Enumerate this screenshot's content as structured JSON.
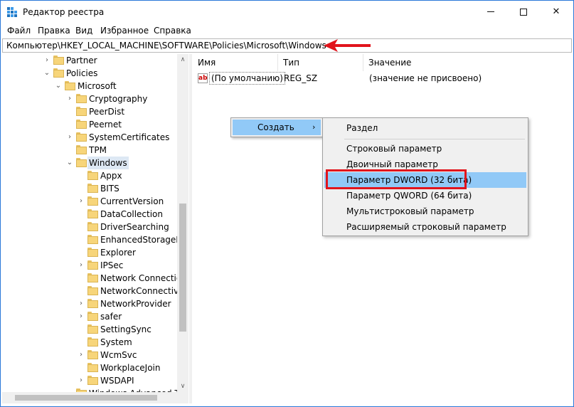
{
  "window": {
    "title": "Редактор реестра",
    "minimize_label": "",
    "maximize_label": "",
    "close_label": "✕"
  },
  "menu": [
    "Файл",
    "Правка",
    "Вид",
    "Избранное",
    "Справка"
  ],
  "address": "Компьютер\\HKEY_LOCAL_MACHINE\\SOFTWARE\\Policies\\Microsoft\\Windows",
  "tree": [
    {
      "label": "Partner",
      "depth": 1,
      "expander": "›"
    },
    {
      "label": "Policies",
      "depth": 1,
      "expander": "⌄"
    },
    {
      "label": "Microsoft",
      "depth": 2,
      "expander": "⌄"
    },
    {
      "label": "Cryptography",
      "depth": 3,
      "expander": "›"
    },
    {
      "label": "PeerDist",
      "depth": 3,
      "expander": ""
    },
    {
      "label": "Peernet",
      "depth": 3,
      "expander": ""
    },
    {
      "label": "SystemCertificates",
      "depth": 3,
      "expander": "›"
    },
    {
      "label": "TPM",
      "depth": 3,
      "expander": ""
    },
    {
      "label": "Windows",
      "depth": 3,
      "expander": "⌄",
      "selected": true
    },
    {
      "label": "Appx",
      "depth": 4,
      "expander": ""
    },
    {
      "label": "BITS",
      "depth": 4,
      "expander": ""
    },
    {
      "label": "CurrentVersion",
      "depth": 4,
      "expander": "›"
    },
    {
      "label": "DataCollection",
      "depth": 4,
      "expander": ""
    },
    {
      "label": "DriverSearching",
      "depth": 4,
      "expander": ""
    },
    {
      "label": "EnhancedStorageDe",
      "depth": 4,
      "expander": ""
    },
    {
      "label": "Explorer",
      "depth": 4,
      "expander": ""
    },
    {
      "label": "IPSec",
      "depth": 4,
      "expander": "›"
    },
    {
      "label": "Network Connection",
      "depth": 4,
      "expander": ""
    },
    {
      "label": "NetworkConnectivit",
      "depth": 4,
      "expander": ""
    },
    {
      "label": "NetworkProvider",
      "depth": 4,
      "expander": "›"
    },
    {
      "label": "safer",
      "depth": 4,
      "expander": "›"
    },
    {
      "label": "SettingSync",
      "depth": 4,
      "expander": ""
    },
    {
      "label": "System",
      "depth": 4,
      "expander": ""
    },
    {
      "label": "WcmSvc",
      "depth": 4,
      "expander": "›"
    },
    {
      "label": "WorkplaceJoin",
      "depth": 4,
      "expander": ""
    },
    {
      "label": "WSDAPI",
      "depth": 4,
      "expander": "›"
    },
    {
      "label": "Windows Advanced Th",
      "depth": 3,
      "expander": ""
    }
  ],
  "columns": {
    "name": "Имя",
    "type": "Тип",
    "value": "Значение"
  },
  "rows": [
    {
      "icon": "ab",
      "name": "(По умолчанию)",
      "type": "REG_SZ",
      "value": "(значение не присвоено)"
    }
  ],
  "context_menu": {
    "create_label": "Создать",
    "create_arrow": "›",
    "submenu": [
      "Раздел",
      "Строковый параметр",
      "Двоичный параметр",
      "Параметр DWORD (32 бита)",
      "Параметр QWORD (64 бита)",
      "Мультистроковый параметр",
      "Расширяемый строковый параметр"
    ],
    "highlighted_index": 3
  },
  "scroll": {
    "up_glyph": "∧",
    "down_glyph": "∨"
  },
  "colors": {
    "highlight": "#91c9f7",
    "annotation_red": "#e1141c",
    "selected_tree": "#dde8f4"
  },
  "icons": [
    "registry-editor-icon",
    "folder-icon",
    "string-value-icon",
    "red-arrow-annotation"
  ]
}
